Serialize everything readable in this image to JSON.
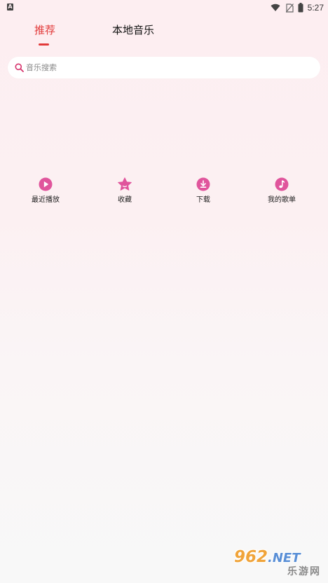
{
  "status_bar": {
    "left_icon": "notification-a-icon",
    "left_icon_letter": "A",
    "icons": [
      "wifi-icon",
      "no-sim-icon",
      "battery-icon"
    ],
    "time": "5:27"
  },
  "tabs": [
    {
      "label": "推荐",
      "active": true
    },
    {
      "label": "本地音乐",
      "active": false
    }
  ],
  "search": {
    "placeholder": "音乐搜索",
    "icon": "search-icon"
  },
  "quick_actions": [
    {
      "label": "最近播放",
      "icon": "play-circle-icon"
    },
    {
      "label": "收藏",
      "icon": "star-icon"
    },
    {
      "label": "下载",
      "icon": "download-circle-icon"
    },
    {
      "label": "我的歌单",
      "icon": "music-note-circle-icon"
    }
  ],
  "watermark": {
    "number": "962",
    "net": ".NET",
    "site": "乐游网"
  },
  "colors": {
    "accent_red": "#e23a3a",
    "icon_pink": "#e0559c",
    "background_top": "#fdeef1",
    "background_bottom": "#f8f8f8"
  }
}
